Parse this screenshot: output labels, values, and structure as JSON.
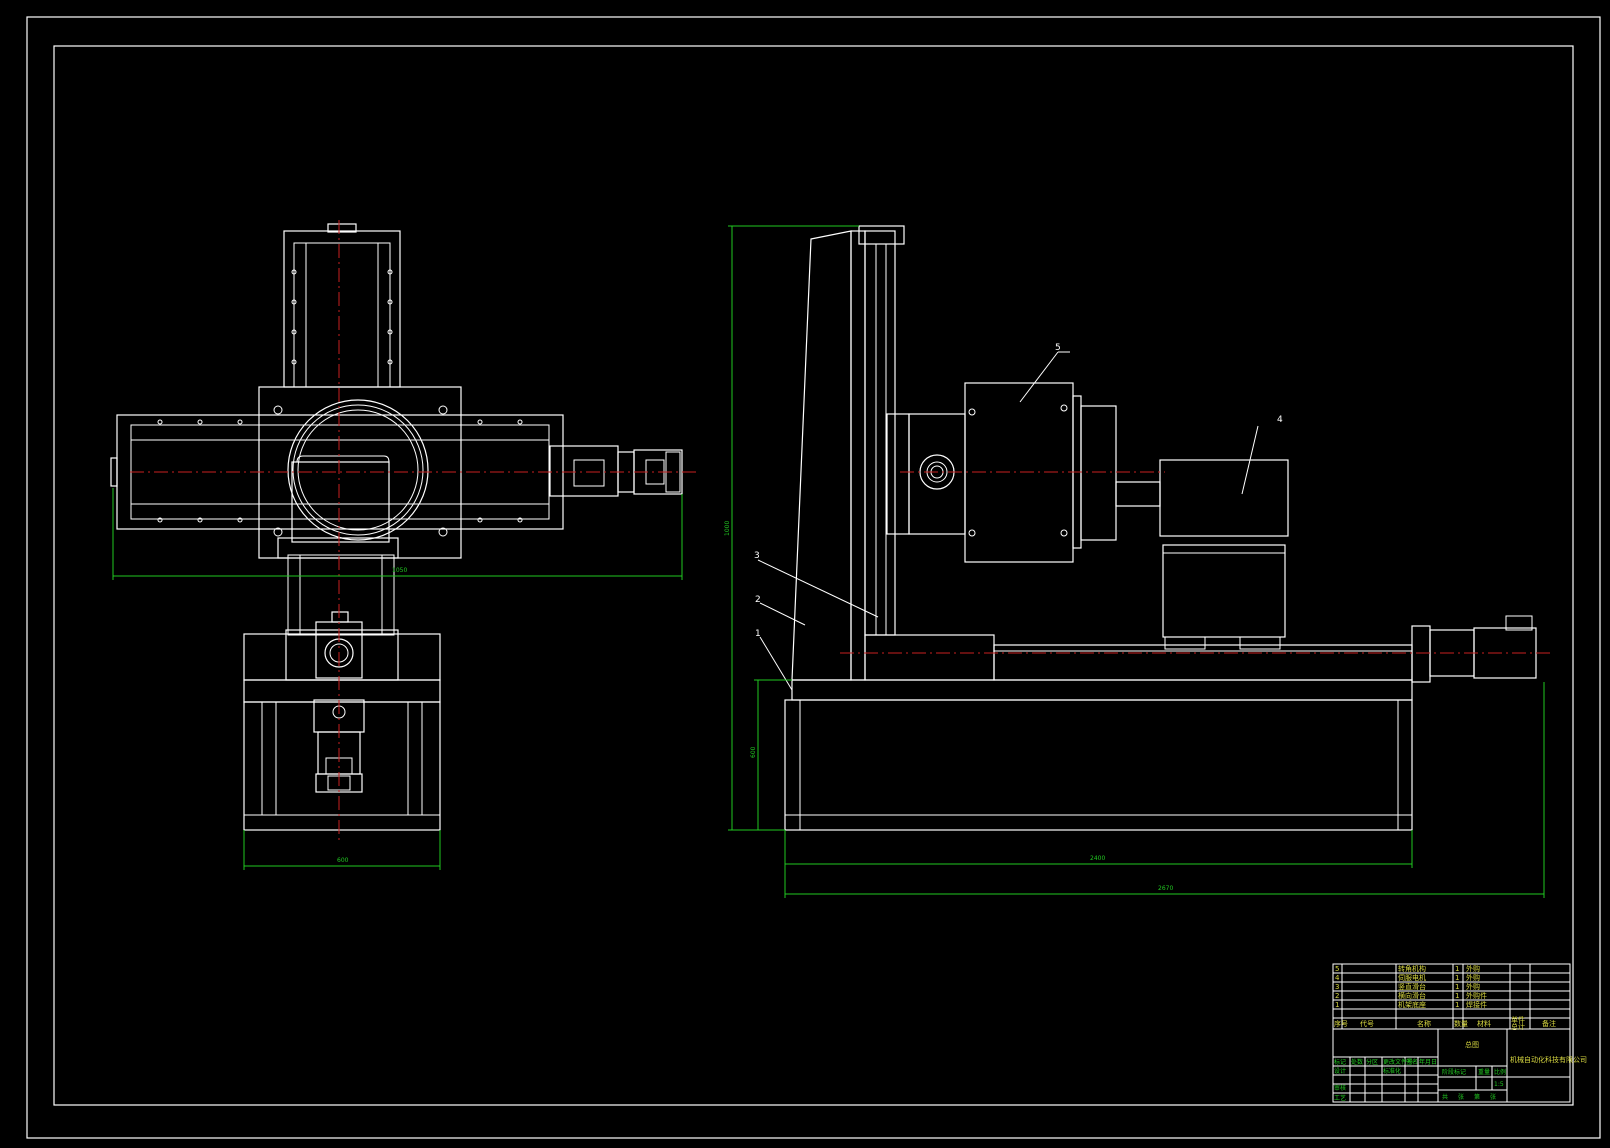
{
  "drawing": {
    "background": "#000000",
    "line_color": "#ffffff",
    "dimension_color": "#21c821",
    "centerline_color": "#c82020"
  },
  "callouts": {
    "c1": "1",
    "c2": "2",
    "c3": "3",
    "c4": "4",
    "c5": "5"
  },
  "dimensions": {
    "front_bottom_width": "600",
    "front_width": "1050",
    "side_height": "1000",
    "side_base_height": "600",
    "side_base_length": "2400",
    "side_total_length": "2670"
  },
  "title_block": {
    "drawing_title": "总图",
    "company": "机械自动化科技有限公司",
    "parts": [
      {
        "no": "5",
        "name": "转角机构",
        "qty": "1",
        "note": "外购"
      },
      {
        "no": "4",
        "name": "伺服电机",
        "qty": "1",
        "note": "外购"
      },
      {
        "no": "3",
        "name": "竖直滑台",
        "qty": "1",
        "note": "外购"
      },
      {
        "no": "2",
        "name": "横向滑台",
        "qty": "1",
        "note": "外购件"
      },
      {
        "no": "1",
        "name": "机架底座",
        "qty": "1",
        "note": "焊接件"
      }
    ],
    "header": {
      "no": "序号",
      "code": "代号",
      "name": "名称",
      "qty": "数量",
      "material": "材料",
      "unit_weight": "单件",
      "total_weight": "总计",
      "note": "备注"
    },
    "sign_labels": [
      "标记",
      "处数",
      "分区",
      "更改文件号",
      "签名",
      "年月日"
    ],
    "roles": [
      "设计",
      "审核",
      "工艺"
    ],
    "std_label": "标准化",
    "stage_label": "阶段标记",
    "weight_label": "重量",
    "scale_label": "比例",
    "scale_value": "1:5",
    "sheet_labels": [
      "共",
      "张",
      "第",
      "张"
    ]
  }
}
